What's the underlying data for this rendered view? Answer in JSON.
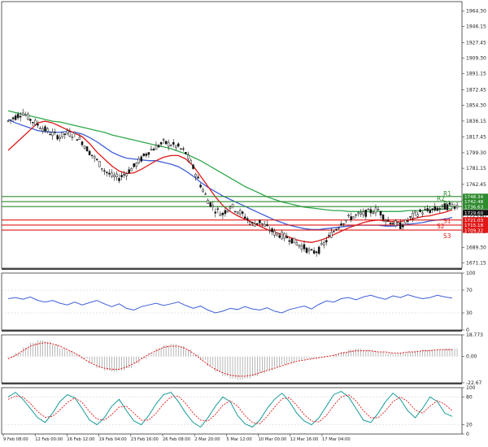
{
  "chart_data": [
    {
      "type": "candlestick",
      "panel": "price",
      "y_ticks": [
        "1964.30",
        "1946.15",
        "1927.45",
        "1909.30",
        "1891.15",
        "1872.45",
        "1854.30",
        "1836.15",
        "1817.45",
        "1799.30",
        "1781.15",
        "1762.45",
        "1744.30",
        "1725.60",
        "1707.45",
        "1689.30",
        "1671.15"
      ],
      "ylim": [
        1665,
        1975
      ],
      "price_path": [
        1836,
        1841,
        1846,
        1838,
        1832,
        1826,
        1821,
        1818,
        1822,
        1820,
        1812,
        1800,
        1790,
        1779,
        1772,
        1770,
        1776,
        1783,
        1792,
        1801,
        1806,
        1811,
        1809,
        1806,
        1799,
        1782,
        1762,
        1744,
        1733,
        1728,
        1738,
        1732,
        1725,
        1716,
        1719,
        1712,
        1706,
        1703,
        1700,
        1694,
        1689,
        1683,
        1686,
        1697,
        1708,
        1718,
        1723,
        1726,
        1728,
        1731,
        1733,
        1722,
        1718,
        1714,
        1720,
        1728,
        1731,
        1732,
        1734,
        1736,
        1738
      ],
      "ma_fast": [
        1802,
        1810,
        1818,
        1826,
        1834,
        1836,
        1834,
        1830,
        1826,
        1822,
        1818,
        1810,
        1800,
        1792,
        1784,
        1778,
        1775,
        1776,
        1780,
        1785,
        1790,
        1794,
        1796,
        1796,
        1792,
        1784,
        1772,
        1760,
        1748,
        1738,
        1731,
        1726,
        1722,
        1718,
        1714,
        1710,
        1707,
        1704,
        1701,
        1698,
        1696,
        1695,
        1697,
        1700,
        1704,
        1708,
        1712,
        1715,
        1718,
        1720,
        1721,
        1720,
        1719,
        1719,
        1721,
        1723,
        1725,
        1726,
        1728,
        1730,
        1733
      ],
      "ma_mid": [
        1838,
        1834,
        1831,
        1828,
        1825,
        1824,
        1823,
        1823,
        1824,
        1823,
        1821,
        1817,
        1812,
        1806,
        1800,
        1796,
        1793,
        1792,
        1791,
        1790,
        1790,
        1788,
        1786,
        1783,
        1778,
        1772,
        1765,
        1759,
        1754,
        1749,
        1745,
        1741,
        1737,
        1733,
        1729,
        1725,
        1721,
        1718,
        1715,
        1713,
        1711,
        1710,
        1710,
        1711,
        1712,
        1713,
        1714,
        1715,
        1715,
        1715,
        1715,
        1714,
        1714,
        1715,
        1716,
        1717,
        1718,
        1720,
        1721,
        1722,
        1724
      ],
      "ma_slow": [
        1848,
        1846,
        1844,
        1842,
        1840,
        1838,
        1836,
        1835,
        1833,
        1831,
        1829,
        1827,
        1825,
        1823,
        1820,
        1818,
        1816,
        1814,
        1812,
        1810,
        1808,
        1806,
        1804,
        1801,
        1798,
        1794,
        1790,
        1785,
        1780,
        1775,
        1770,
        1765,
        1760,
        1756,
        1752,
        1748,
        1745,
        1742,
        1740,
        1738,
        1736,
        1735,
        1734,
        1733,
        1732,
        1732,
        1731,
        1731,
        1731,
        1731,
        1731,
        1731,
        1731,
        1731,
        1732,
        1732,
        1732,
        1733,
        1733,
        1734,
        1734
      ],
      "levels": [
        {
          "name": "R1",
          "value": "1748.34",
          "y": 1748.34,
          "color": "#2e8b2e",
          "label_side": "right"
        },
        {
          "name": "R2",
          "value": "1742.48",
          "y": 1742.48,
          "color": "#2e8b2e",
          "label_side": "right"
        },
        {
          "name": "R1",
          "value": "1736.63",
          "y": 1736.63,
          "color": "#2e8b2e",
          "label_side": "right"
        },
        {
          "name": "S1",
          "value": "1721.03",
          "y": 1721.03,
          "color": "#e01818",
          "label_side": "right"
        },
        {
          "name": "S2",
          "value": "1715.18",
          "y": 1715.18,
          "color": "#e01818",
          "label_side": "right"
        },
        {
          "name": "S3",
          "value": "1709.32",
          "y": 1709.32,
          "color": "#e01818",
          "label_side": "right"
        }
      ],
      "current_price": "1729.60",
      "colors": {
        "ma_fast": "#e01818",
        "ma_mid": "#3f5fd8",
        "ma_slow": "#2ea84a",
        "candle": "#111111",
        "current_bg": "#111111"
      }
    },
    {
      "type": "line",
      "panel": "oscillator_1",
      "y_ticks": [
        "100",
        "70",
        "30",
        "0"
      ],
      "ylim": [
        0,
        100
      ],
      "values": [
        55,
        57,
        54,
        58,
        52,
        49,
        52,
        47,
        44,
        49,
        44,
        48,
        52,
        46,
        41,
        46,
        38,
        35,
        41,
        44,
        47,
        43,
        46,
        49,
        43,
        38,
        42,
        35,
        30,
        33,
        38,
        36,
        41,
        37,
        35,
        39,
        33,
        30,
        36,
        39,
        42,
        37,
        45,
        51,
        49,
        55,
        57,
        53,
        58,
        61,
        57,
        54,
        60,
        57,
        62,
        58,
        55,
        57,
        61,
        58,
        56
      ],
      "color": "#3f5fd8"
    },
    {
      "type": "histogram",
      "panel": "oscillator_2",
      "y_ticks": [
        "18.773",
        "0.00",
        "-22.67"
      ],
      "ylim": [
        -22.67,
        18.773
      ],
      "values": [
        -1,
        3,
        8,
        12,
        14,
        13,
        10,
        7,
        5,
        2,
        -2,
        -6,
        -10,
        -12,
        -13,
        -12,
        -10,
        -6,
        -2,
        3,
        7,
        10,
        11,
        9,
        6,
        2,
        -3,
        -8,
        -13,
        -17,
        -19,
        -20,
        -19,
        -17,
        -14,
        -12,
        -9,
        -7,
        -5,
        -3,
        -2,
        -2,
        -1,
        0,
        2,
        4,
        6,
        7,
        6,
        5,
        4,
        3,
        2,
        3,
        4,
        5,
        6,
        6,
        6,
        7,
        7
      ],
      "signal": [
        -2,
        1,
        5,
        9,
        11,
        12,
        11,
        9,
        6,
        3,
        -1,
        -5,
        -8,
        -10,
        -11,
        -11,
        -9,
        -6,
        -2,
        2,
        5,
        8,
        9,
        9,
        7,
        3,
        -2,
        -7,
        -11,
        -14,
        -16,
        -17,
        -17,
        -16,
        -14,
        -12,
        -10,
        -8,
        -6,
        -4,
        -3,
        -2,
        -1,
        0,
        1,
        3,
        4,
        5,
        5,
        5,
        4,
        4,
        3,
        3,
        4,
        4,
        5,
        5,
        6,
        6,
        6
      ],
      "color": "#9a9a9a",
      "signal_color": "#e01818"
    },
    {
      "type": "line",
      "panel": "oscillator_3",
      "y_ticks": [
        "100",
        "80",
        "20",
        "0"
      ],
      "ylim": [
        0,
        100
      ],
      "values": [
        80,
        90,
        75,
        55,
        35,
        25,
        45,
        70,
        85,
        78,
        55,
        30,
        20,
        35,
        60,
        75,
        50,
        28,
        20,
        40,
        65,
        85,
        90,
        70,
        45,
        25,
        15,
        35,
        60,
        80,
        70,
        40,
        22,
        15,
        30,
        55,
        75,
        88,
        70,
        45,
        28,
        20,
        35,
        60,
        85,
        92,
        80,
        55,
        30,
        25,
        45,
        70,
        88,
        75,
        50,
        35,
        55,
        80,
        70,
        45,
        38
      ],
      "signal": [
        75,
        82,
        80,
        66,
        48,
        36,
        38,
        52,
        68,
        78,
        68,
        48,
        32,
        30,
        42,
        58,
        60,
        45,
        30,
        30,
        45,
        65,
        80,
        82,
        66,
        45,
        30,
        28,
        42,
        62,
        72,
        60,
        40,
        25,
        22,
        38,
        58,
        76,
        78,
        62,
        42,
        28,
        26,
        40,
        62,
        80,
        85,
        72,
        50,
        35,
        35,
        50,
        70,
        80,
        70,
        52,
        45,
        60,
        72,
        64,
        50
      ],
      "color": "#1a9a9a",
      "signal_color": "#e01818"
    }
  ],
  "x_ticks": [
    "9 Feb 08:00",
    "12 Feb 00:00",
    "16 Feb 12:00",
    "19 Feb 04:00",
    "23 Feb 16:00",
    "26 Feb 08:00",
    "2 Mar 20:00",
    "5 Mar 12:00",
    "10 Mar 00:00",
    "12 Mar 16:00",
    "17 Mar 04:00"
  ]
}
